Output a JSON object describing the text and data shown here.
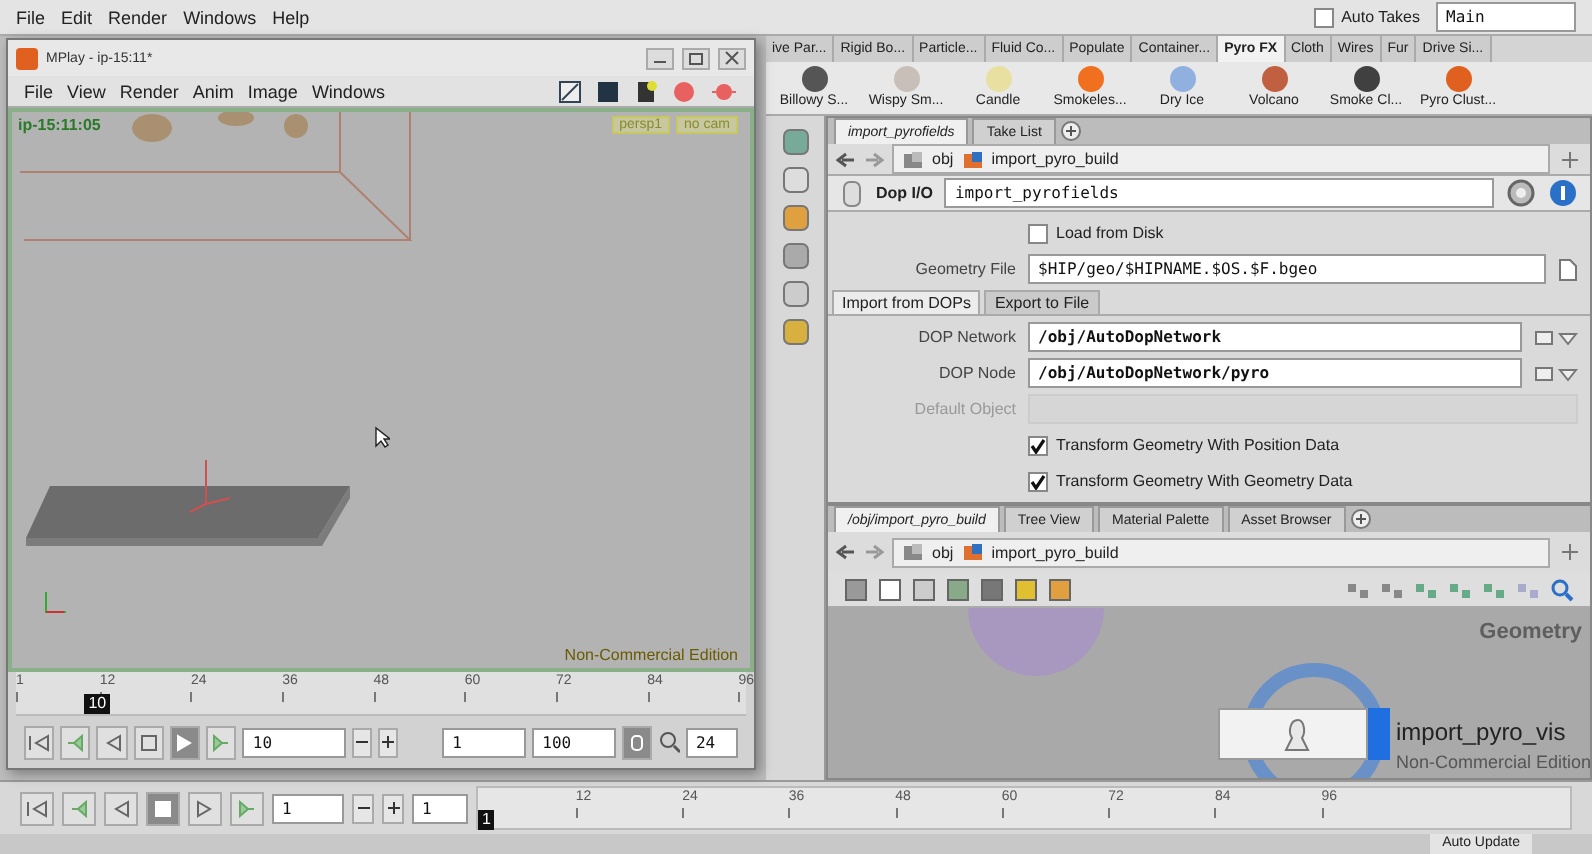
{
  "main_window": {
    "menu": [
      "File",
      "Edit",
      "Render",
      "Windows",
      "Help"
    ],
    "auto_takes": {
      "label": "Auto Takes",
      "checked": false
    },
    "take": "Main"
  },
  "shelf": {
    "tabs": [
      {
        "label": "ive Par...",
        "selected": false
      },
      {
        "label": "Rigid Bo...",
        "selected": false
      },
      {
        "label": "Particle...",
        "selected": false
      },
      {
        "label": "Fluid Co...",
        "selected": false
      },
      {
        "label": "Populate",
        "selected": false
      },
      {
        "label": "Container...",
        "selected": false
      },
      {
        "label": "Pyro FX",
        "selected": true
      },
      {
        "label": "Cloth",
        "selected": false
      },
      {
        "label": "Wires",
        "selected": false
      },
      {
        "label": "Fur",
        "selected": false
      },
      {
        "label": "Drive Si...",
        "selected": false
      }
    ],
    "tools": [
      {
        "label": "Billowy S...",
        "color": "#555555"
      },
      {
        "label": "Wispy Sm...",
        "color": "#c8c0b8"
      },
      {
        "label": "Candle",
        "color": "#e8e0a0"
      },
      {
        "label": "Smokeles...",
        "color": "#f07020"
      },
      {
        "label": "Dry Ice",
        "color": "#90b0e0"
      },
      {
        "label": "Volcano",
        "color": "#c06040"
      },
      {
        "label": "Smoke Cl...",
        "color": "#404040"
      },
      {
        "label": "Pyro Clust...",
        "color": "#e06020"
      }
    ]
  },
  "parameter_pane": {
    "tabs": [
      {
        "label": "import_pyrofields",
        "selected": true
      },
      {
        "label": "Take List",
        "selected": false
      }
    ],
    "path": [
      "obj",
      "import_pyro_build"
    ],
    "node_type": "Dop I/O",
    "node_name": "import_pyrofields",
    "load_from_disk": {
      "label": "Load from Disk",
      "checked": false
    },
    "geometry_file": {
      "label": "Geometry File",
      "value": "$HIP/geo/$HIPNAME.$OS.$F.bgeo"
    },
    "subtabs": [
      {
        "label": "Import from DOPs",
        "selected": true
      },
      {
        "label": "Export to File",
        "selected": false
      }
    ],
    "fields": [
      {
        "label": "DOP Network",
        "value": "/obj/AutoDopNetwork",
        "disabled": false
      },
      {
        "label": "DOP Node",
        "value": "/obj/AutoDopNetwork/pyro",
        "disabled": false
      },
      {
        "label": "Default Object",
        "disabled": true
      }
    ],
    "checkboxes": [
      {
        "label": "Transform Geometry With Position Data",
        "checked": true
      },
      {
        "label": "Transform Geometry With Geometry Data",
        "checked": true
      }
    ]
  },
  "network_pane": {
    "tabs": [
      {
        "label": "/obj/import_pyro_build",
        "selected": true
      },
      {
        "label": "Tree View",
        "selected": false
      },
      {
        "label": "Material Palette",
        "selected": false
      },
      {
        "label": "Asset Browser",
        "selected": false
      }
    ],
    "path": [
      "obj",
      "import_pyro_build"
    ],
    "context": "Geometry",
    "node": {
      "name": "import_pyro_vis",
      "display": true
    },
    "edition": "Non-Commercial Edition"
  },
  "timeline": {
    "transport": [
      {
        "kind": "start",
        "selected": false
      },
      {
        "kind": "prevkey",
        "selected": false
      },
      {
        "kind": "reverse",
        "selected": false
      },
      {
        "kind": "stop",
        "selected": true
      },
      {
        "kind": "play",
        "selected": false
      },
      {
        "kind": "nextkey",
        "selected": false
      }
    ],
    "frame": "1",
    "start": "1",
    "current": "1",
    "ticks": [
      "12",
      "24",
      "36",
      "48",
      "60",
      "72",
      "84",
      "96"
    ]
  },
  "status_bar": {
    "auto_update": "Auto Update"
  },
  "mplay": {
    "title": "MPlay - ip-15:11*",
    "menu": [
      "File",
      "View",
      "Render",
      "Anim",
      "Image",
      "Windows"
    ],
    "frame_label": "ip-15:11:05",
    "camera_menus": [
      "persp1",
      "no cam"
    ],
    "edition": "Non-Commercial Edition",
    "ticks": [
      "1",
      "12",
      "24",
      "36",
      "48",
      "60",
      "72",
      "84",
      "96"
    ],
    "current": "10",
    "transport": [
      {
        "kind": "start",
        "selected": false
      },
      {
        "kind": "prevkey",
        "selected": false
      },
      {
        "kind": "reverse",
        "selected": false
      },
      {
        "kind": "stop",
        "selected": false
      },
      {
        "kind": "play",
        "selected": true
      },
      {
        "kind": "nextkey",
        "selected": false
      }
    ],
    "frame": "10",
    "range_start": "1",
    "range_end": "100",
    "realtime": true,
    "fps": "24"
  }
}
